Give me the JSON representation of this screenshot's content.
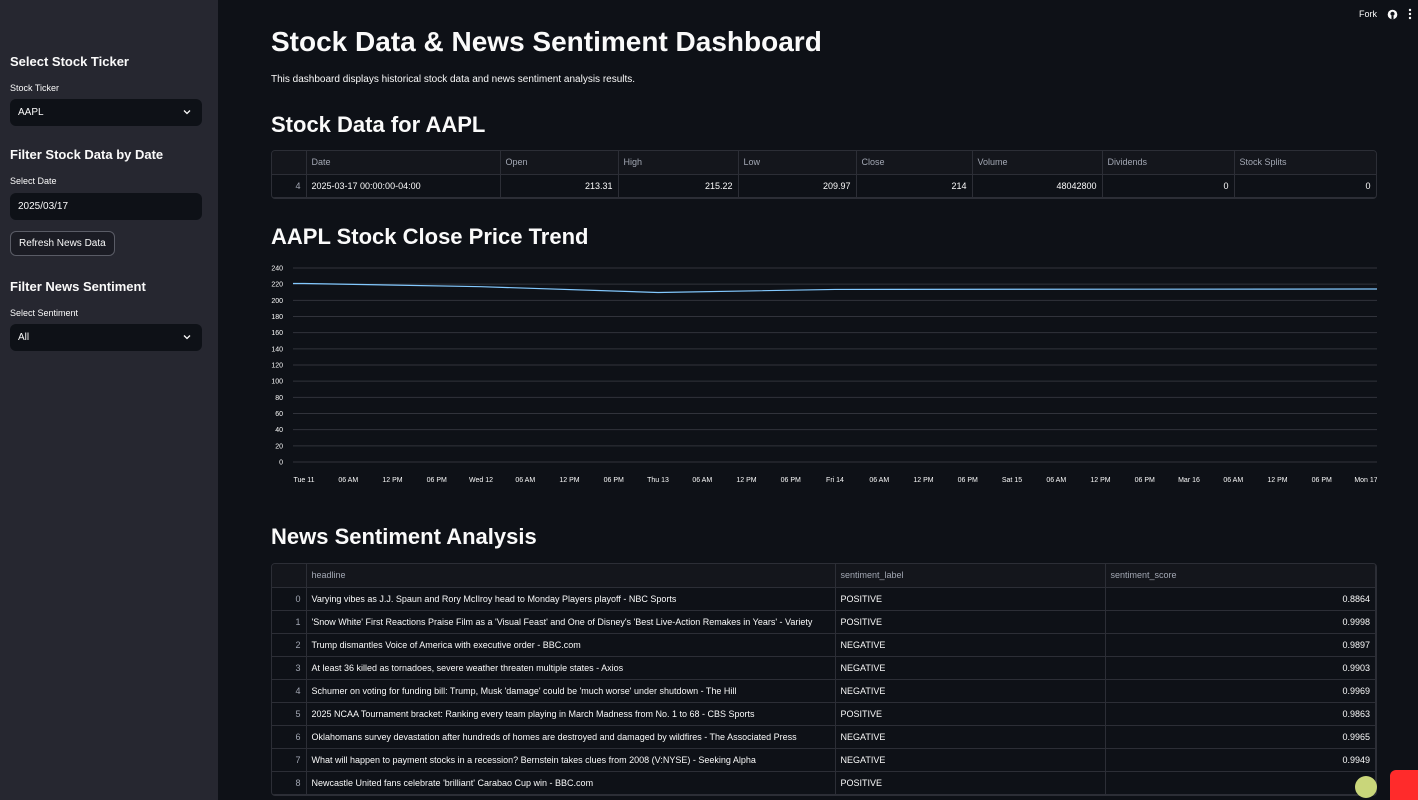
{
  "topbar": {
    "fork_label": "Fork",
    "github_icon": "github-icon",
    "menu_icon": "kebab-menu-icon"
  },
  "sidebar": {
    "ticker_heading": "Select Stock Ticker",
    "ticker_label": "Stock Ticker",
    "ticker_value": "AAPL",
    "date_heading": "Filter Stock Data by Date",
    "date_label": "Select Date",
    "date_value": "2025/03/17",
    "refresh_button": "Refresh News Data",
    "sentiment_heading": "Filter News Sentiment",
    "sentiment_label": "Select Sentiment",
    "sentiment_value": "All"
  },
  "main": {
    "title": "Stock Data & News Sentiment Dashboard",
    "description": "This dashboard displays historical stock data and news sentiment analysis results.",
    "stock_heading": "Stock Data for AAPL",
    "stock_table": {
      "columns": [
        "Date",
        "Open",
        "High",
        "Low",
        "Close",
        "Volume",
        "Dividends",
        "Stock Splits"
      ],
      "rows": [
        {
          "index": "4",
          "cells": [
            "2025-03-17 00:00:00-04:00",
            "213.31",
            "215.22",
            "209.97",
            "214",
            "48042800",
            "0",
            "0"
          ]
        }
      ]
    },
    "chart_heading": "AAPL Stock Close Price Trend",
    "news_heading": "News Sentiment Analysis",
    "news_table": {
      "columns": [
        "headline",
        "sentiment_label",
        "sentiment_score"
      ],
      "rows": [
        {
          "index": "0",
          "headline": "Varying vibes as J.J. Spaun and Rory McIlroy head to Monday Players playoff - NBC Sports",
          "label": "POSITIVE",
          "score": "0.8864"
        },
        {
          "index": "1",
          "headline": "'Snow White' First Reactions Praise Film as a 'Visual Feast' and One of Disney's 'Best Live-Action Remakes in Years' - Variety",
          "label": "POSITIVE",
          "score": "0.9998"
        },
        {
          "index": "2",
          "headline": "Trump dismantles Voice of America with executive order - BBC.com",
          "label": "NEGATIVE",
          "score": "0.9897"
        },
        {
          "index": "3",
          "headline": "At least 36 killed as tornadoes, severe weather threaten multiple states - Axios",
          "label": "NEGATIVE",
          "score": "0.9903"
        },
        {
          "index": "4",
          "headline": "Schumer on voting for funding bill: Trump, Musk 'damage' could be 'much worse' under shutdown - The Hill",
          "label": "NEGATIVE",
          "score": "0.9969"
        },
        {
          "index": "5",
          "headline": "2025 NCAA Tournament bracket: Ranking every team playing in March Madness from No. 1 to 68 - CBS Sports",
          "label": "POSITIVE",
          "score": "0.9863"
        },
        {
          "index": "6",
          "headline": "Oklahomans survey devastation after hundreds of homes are destroyed and damaged by wildfires - The Associated Press",
          "label": "NEGATIVE",
          "score": "0.9965"
        },
        {
          "index": "7",
          "headline": "What will happen to payment stocks in a recession? Bernstein takes clues from 2008 (V:NYSE) - Seeking Alpha",
          "label": "NEGATIVE",
          "score": "0.9949"
        },
        {
          "index": "8",
          "headline": "Newcastle United fans celebrate 'brilliant' Carabao Cup win - BBC.com",
          "label": "POSITIVE",
          "score": "0.9"
        }
      ]
    }
  },
  "chart_data": {
    "type": "line",
    "title": "AAPL Stock Close Price Trend",
    "xlabel": "",
    "ylabel": "",
    "ylim": [
      0,
      240
    ],
    "yticks": [
      0,
      20,
      40,
      60,
      80,
      100,
      120,
      140,
      160,
      180,
      200,
      220,
      240
    ],
    "xticks": [
      "Tue 11",
      "06 AM",
      "12 PM",
      "06 PM",
      "Wed 12",
      "06 AM",
      "12 PM",
      "06 PM",
      "Thu 13",
      "06 AM",
      "12 PM",
      "06 PM",
      "Fri 14",
      "06 AM",
      "12 PM",
      "06 PM",
      "Sat 15",
      "06 AM",
      "12 PM",
      "06 PM",
      "Mar 16",
      "06 AM",
      "12 PM",
      "06 PM",
      "Mon 17"
    ],
    "x": [
      "2025-03-11",
      "2025-03-12",
      "2025-03-13",
      "2025-03-14",
      "2025-03-17"
    ],
    "series": [
      {
        "values": [
          220.8,
          216.9,
          209.7,
          213.5,
          214
        ]
      }
    ],
    "line_color": "#83c9ff",
    "grid": true
  }
}
